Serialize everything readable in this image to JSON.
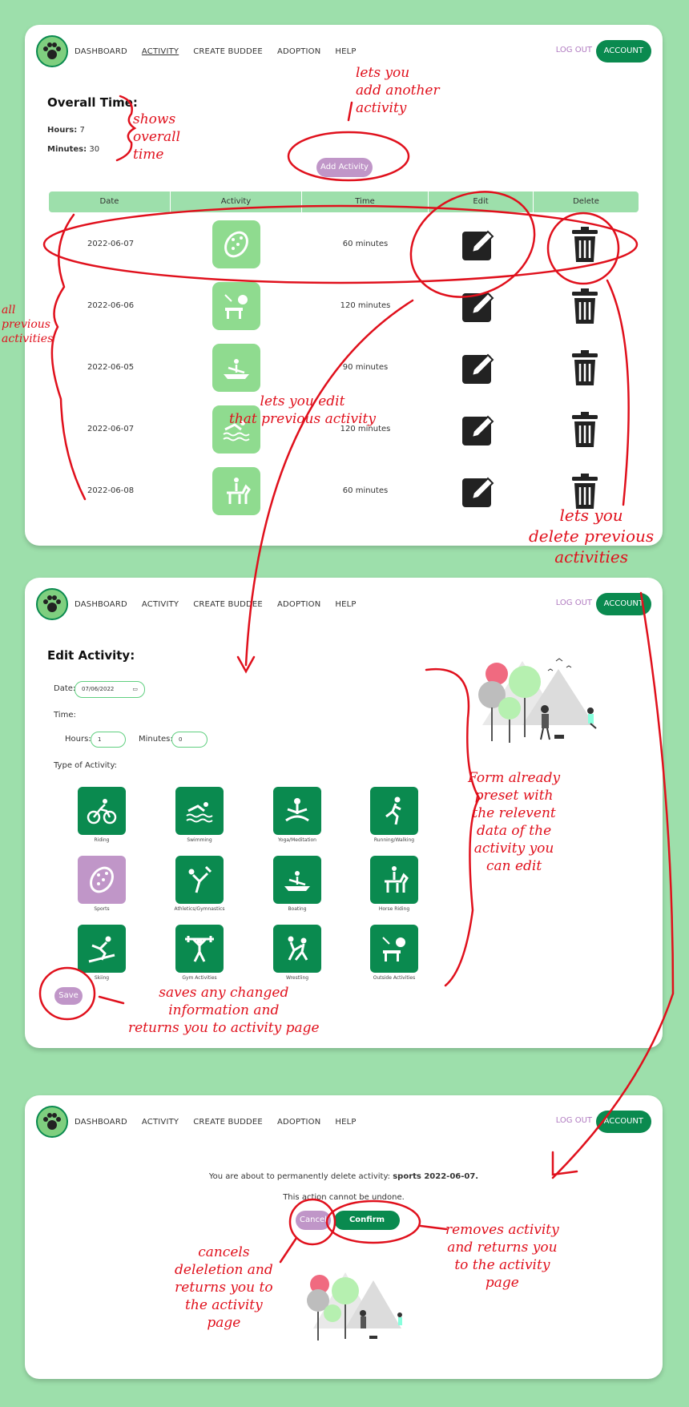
{
  "nav": {
    "links": [
      "DASHBOARD",
      "ACTIVITY",
      "CREATE BUDDEE",
      "ADOPTION",
      "HELP"
    ],
    "logout": "LOG OUT",
    "account": "ACCOUNT"
  },
  "activity_page": {
    "title": "Overall Time:",
    "hours_label": "Hours:",
    "hours_value": "7",
    "minutes_label": "Minutes:",
    "minutes_value": "30",
    "add_button": "Add Activity",
    "columns": [
      "Date",
      "Activity",
      "Time",
      "Edit",
      "Delete"
    ],
    "rows": [
      {
        "date": "2022-06-07",
        "activity_icon": "sports-shoe-icon",
        "time": "60 minutes"
      },
      {
        "date": "2022-06-06",
        "activity_icon": "outside-activities-icon",
        "time": "120 minutes"
      },
      {
        "date": "2022-06-05",
        "activity_icon": "boating-icon",
        "time": "90 minutes"
      },
      {
        "date": "2022-06-07",
        "activity_icon": "swimming-icon",
        "time": "120 minutes"
      },
      {
        "date": "2022-06-08",
        "activity_icon": "horse-riding-icon",
        "time": "60 minutes"
      }
    ]
  },
  "edit_page": {
    "title": "Edit Activity:",
    "date_label": "Date:",
    "date_value": "07/06/2022",
    "time_label": "Time:",
    "hours_label": "Hours:",
    "hours_value": "1",
    "minutes_label": "Minutes:",
    "minutes_value": "0",
    "type_label": "Type of Activity:",
    "types": [
      {
        "label": "Riding",
        "icon": "cycling-icon",
        "selected": false
      },
      {
        "label": "Swimming",
        "icon": "swimming-icon",
        "selected": false
      },
      {
        "label": "Yoga/Meditation",
        "icon": "yoga-icon",
        "selected": false
      },
      {
        "label": "Running/Walking",
        "icon": "running-icon",
        "selected": false
      },
      {
        "label": "Sports",
        "icon": "sports-shoe-icon",
        "selected": true
      },
      {
        "label": "Athletics/Gymnastics",
        "icon": "gymnastics-icon",
        "selected": false
      },
      {
        "label": "Boating",
        "icon": "boating-icon",
        "selected": false
      },
      {
        "label": "Horse Riding",
        "icon": "horse-riding-icon",
        "selected": false
      },
      {
        "label": "Skiing",
        "icon": "skiing-icon",
        "selected": false
      },
      {
        "label": "Gym Activities",
        "icon": "weightlifting-icon",
        "selected": false
      },
      {
        "label": "Wrestling",
        "icon": "wrestling-icon",
        "selected": false
      },
      {
        "label": "Outside Activities",
        "icon": "outside-activities-icon",
        "selected": false
      }
    ],
    "save_button": "Save"
  },
  "delete_page": {
    "message_prefix": "You are about to permanently delete activity:",
    "message_bold": "sports 2022-06-07.",
    "warning": "This action cannot be undone.",
    "cancel_button": "Cancel",
    "confirm_button": "Confirm delete"
  },
  "annotations": {
    "add_activity": "lets you\nadd another\nactivity",
    "overall_time": "shows\noverall\ntime",
    "previous_activities": "all\nprevious\nactivities",
    "edit_previous": "lets you edit\nthat previous activity",
    "delete_previous": "lets you\ndelete previous\nactivities",
    "form_preset": "Form already\npreset with\nthe relevent\ndata of the\nactivity you\ncan edit",
    "saves": "saves any changed\ninformation and\nreturns you to activity page",
    "cancels": "cancels\ndeleletion and\nreturns you to\nthe activity\npage",
    "removes": "removes activity\nand returns you\nto the activity\npage"
  },
  "colors": {
    "background": "#9ddfab",
    "brand_green": "#0a8a4f",
    "light_green": "#8fdb8f",
    "purple": "#c096c8",
    "annotation_red": "#e0101c"
  }
}
